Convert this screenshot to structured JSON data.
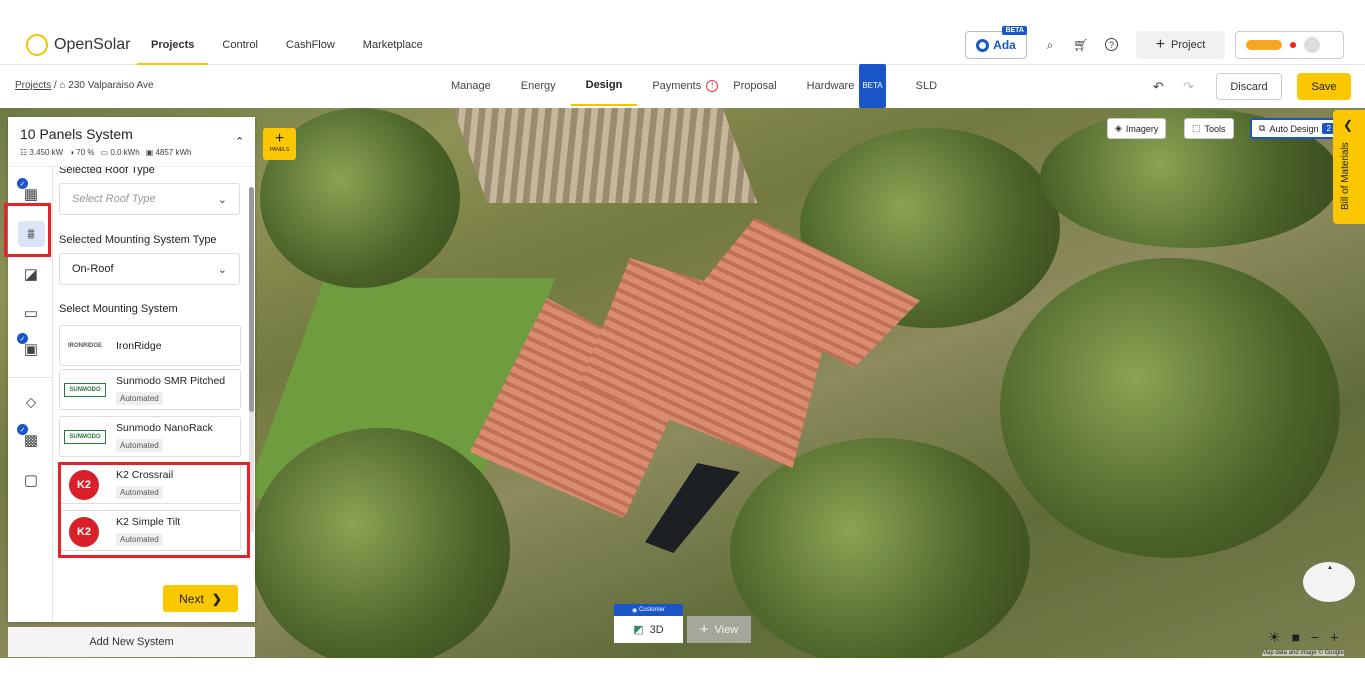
{
  "app": {
    "logo_text": "OpenSolar"
  },
  "nav": {
    "items": [
      "Projects",
      "Control",
      "CashFlow",
      "Marketplace"
    ]
  },
  "toolbar": {
    "ada_label": "Ada",
    "ada_beta": "BETA",
    "project_button": "Project",
    "save_label": "Save",
    "discard_label": "Discard"
  },
  "breadcrumb": {
    "root": "Projects",
    "current": "230 Valparaiso Ave"
  },
  "tabs": {
    "manage": "Manage",
    "energy": "Energy",
    "design": "Design",
    "payments": "Payments",
    "proposal": "Proposal",
    "hardware": "Hardware",
    "hardware_badge": "BETA",
    "sld": "SLD"
  },
  "map": {
    "imagery": "Imagery",
    "tools": "Tools",
    "auto_design": "Auto Design",
    "auto_design_count": "2",
    "bom": "Bill of Materials",
    "panels_label": "PANELS",
    "customer": "Customer",
    "view3d": "3D",
    "view_label": "View",
    "attribution": "Map data and image © Google"
  },
  "panel": {
    "title": "10 Panels System",
    "stats": {
      "kw": "3.450 kW",
      "pct": "70 %",
      "batt": "0.0 kWh",
      "prod": "4857 kWh"
    },
    "roof_type_label": "Selected Roof Type",
    "roof_type_placeholder": "Select Roof Type",
    "mount_type_label": "Selected Mounting System Type",
    "mount_type_value": "On-Roof",
    "select_mount_label": "Select Mounting System",
    "mounting_systems": [
      {
        "name": "IronRidge",
        "logo": "IRONRIDGE",
        "badge": ""
      },
      {
        "name": "Sunmodo SMR Pitched",
        "logo": "SUNMODO",
        "badge": "Automated"
      },
      {
        "name": "Sunmodo NanoRack",
        "logo": "SUNMODO",
        "badge": "Automated"
      },
      {
        "name": "K2 Crossrail",
        "logo": "K2",
        "badge": "Automated"
      },
      {
        "name": "K2 Simple Tilt",
        "logo": "K2",
        "badge": "Automated"
      }
    ],
    "next": "Next",
    "add_system": "Add New System"
  },
  "colors": {
    "accent": "#fbc700",
    "brand_blue": "#1a56c8",
    "highlight_red": "#e8222b"
  }
}
